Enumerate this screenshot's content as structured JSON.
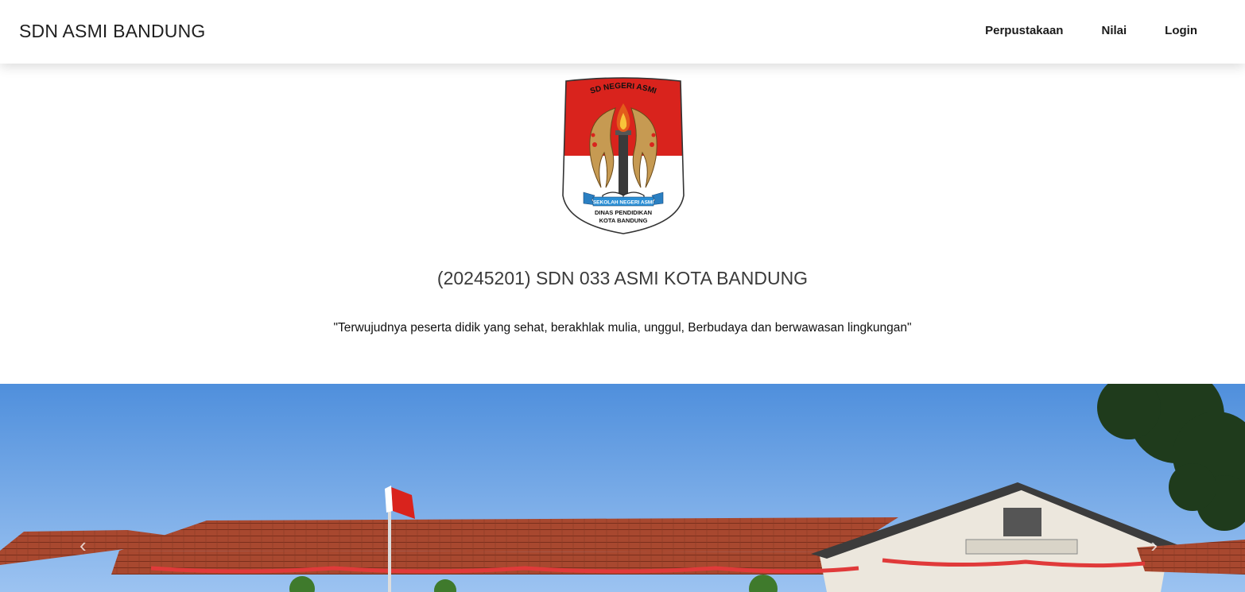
{
  "navbar": {
    "brand": "SDN ASMI BANDUNG",
    "links": [
      {
        "label": "Perpustakaan"
      },
      {
        "label": "Nilai"
      },
      {
        "label": "Login"
      }
    ]
  },
  "logo": {
    "top_text": "SD NEGERI ASMI",
    "ribbon_text": "SEKOLAH NEGERI ASMI",
    "line1": "DINAS PENDIDIKAN",
    "line2": "KOTA BANDUNG"
  },
  "school": {
    "title": "(20245201) SDN 033 ASMI KOTA BANDUNG",
    "motto": "\"Terwujudnya peserta didik yang sehat, berakhlak mulia, unggul, Berbudaya dan berwawasan lingkungan\""
  },
  "carousel": {
    "prev_icon": "chevron-left-icon",
    "next_icon": "chevron-right-icon"
  },
  "colors": {
    "logo_red": "#d9231d",
    "logo_gold": "#c69a52",
    "sky": "#5f9be0",
    "roof": "#a8482f"
  }
}
